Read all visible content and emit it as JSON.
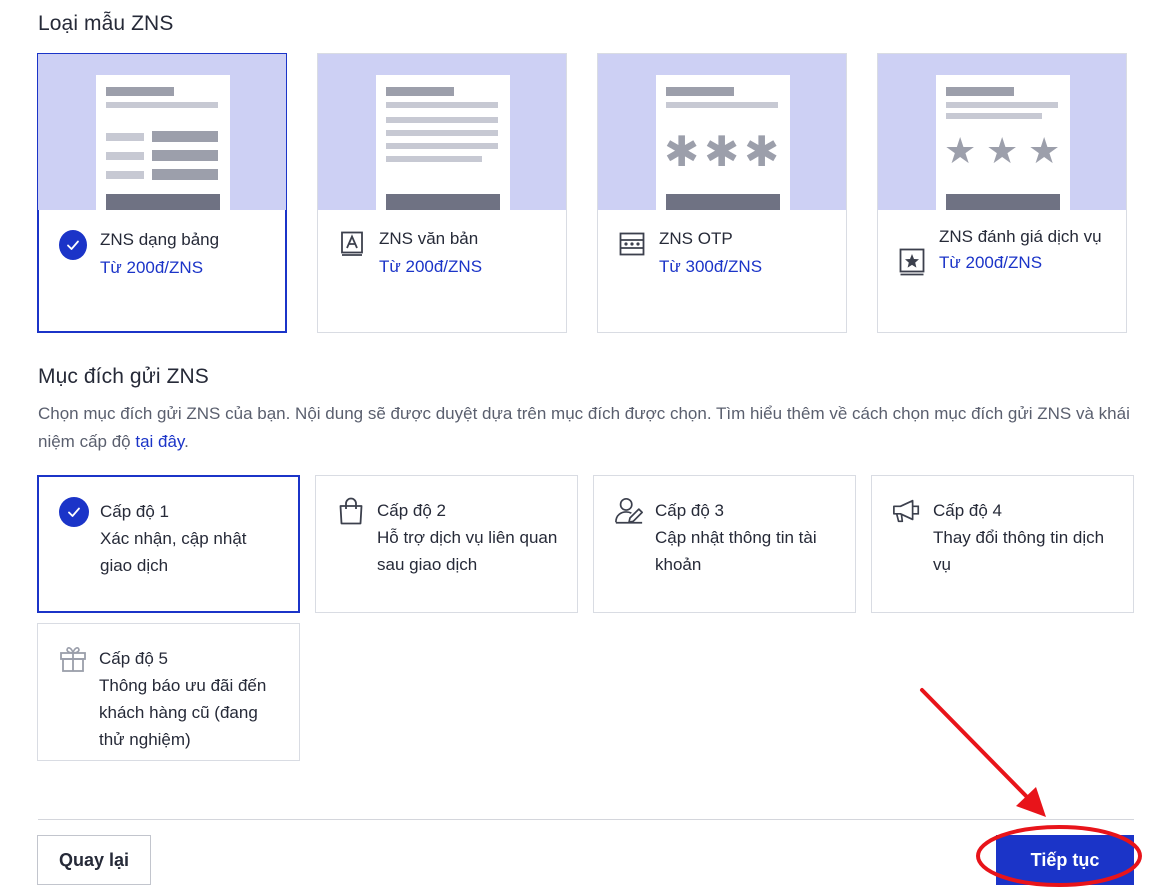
{
  "template_section": {
    "title": "Loại mẫu ZNS"
  },
  "templates": [
    {
      "name": "ZNS dạng bảng",
      "price": "Từ 200đ/ZNS",
      "selected": true,
      "icon": "table-check-icon"
    },
    {
      "name": "ZNS văn bản",
      "price": "Từ 200đ/ZNS",
      "selected": false,
      "icon": "text-doc-icon"
    },
    {
      "name": "ZNS OTP",
      "price": "Từ 300đ/ZNS",
      "selected": false,
      "icon": "otp-icon"
    },
    {
      "name": "ZNS đánh giá dịch vụ",
      "price": "Từ 200đ/ZNS",
      "selected": false,
      "icon": "star-doc-icon"
    }
  ],
  "purpose_section": {
    "title": "Mục đích gửi ZNS",
    "description": "Chọn mục đích gửi ZNS của bạn. Nội dung sẽ được duyệt dựa trên mục đích được chọn. Tìm hiểu thêm về cách chọn mục đích gửi ZNS và khái niệm cấp độ ",
    "link": "tại đây",
    "suffix": "."
  },
  "levels": [
    {
      "title": "Cấp độ 1",
      "desc": "Xác nhận, cập nhật giao dịch",
      "selected": true,
      "icon": "check-icon"
    },
    {
      "title": "Cấp độ 2",
      "desc": "Hỗ trợ dịch vụ liên quan sau giao dịch",
      "selected": false,
      "icon": "shopping-bag-icon"
    },
    {
      "title": "Cấp độ 3",
      "desc": "Cập nhật thông tin tài khoản",
      "selected": false,
      "icon": "user-edit-icon"
    },
    {
      "title": "Cấp độ 4",
      "desc": "Thay đổi thông tin dịch vụ",
      "selected": false,
      "icon": "megaphone-icon"
    },
    {
      "title": "Cấp độ 5",
      "desc": "Thông báo ưu đãi đến khách hàng cũ (đang thử nghiệm)",
      "selected": false,
      "icon": "gift-icon"
    }
  ],
  "actions": {
    "back": "Quay lại",
    "next": "Tiếp tục"
  },
  "colors": {
    "accent": "#1b34c8",
    "preview_bg": "#cdd0f4",
    "annotation": "#e8141a"
  }
}
